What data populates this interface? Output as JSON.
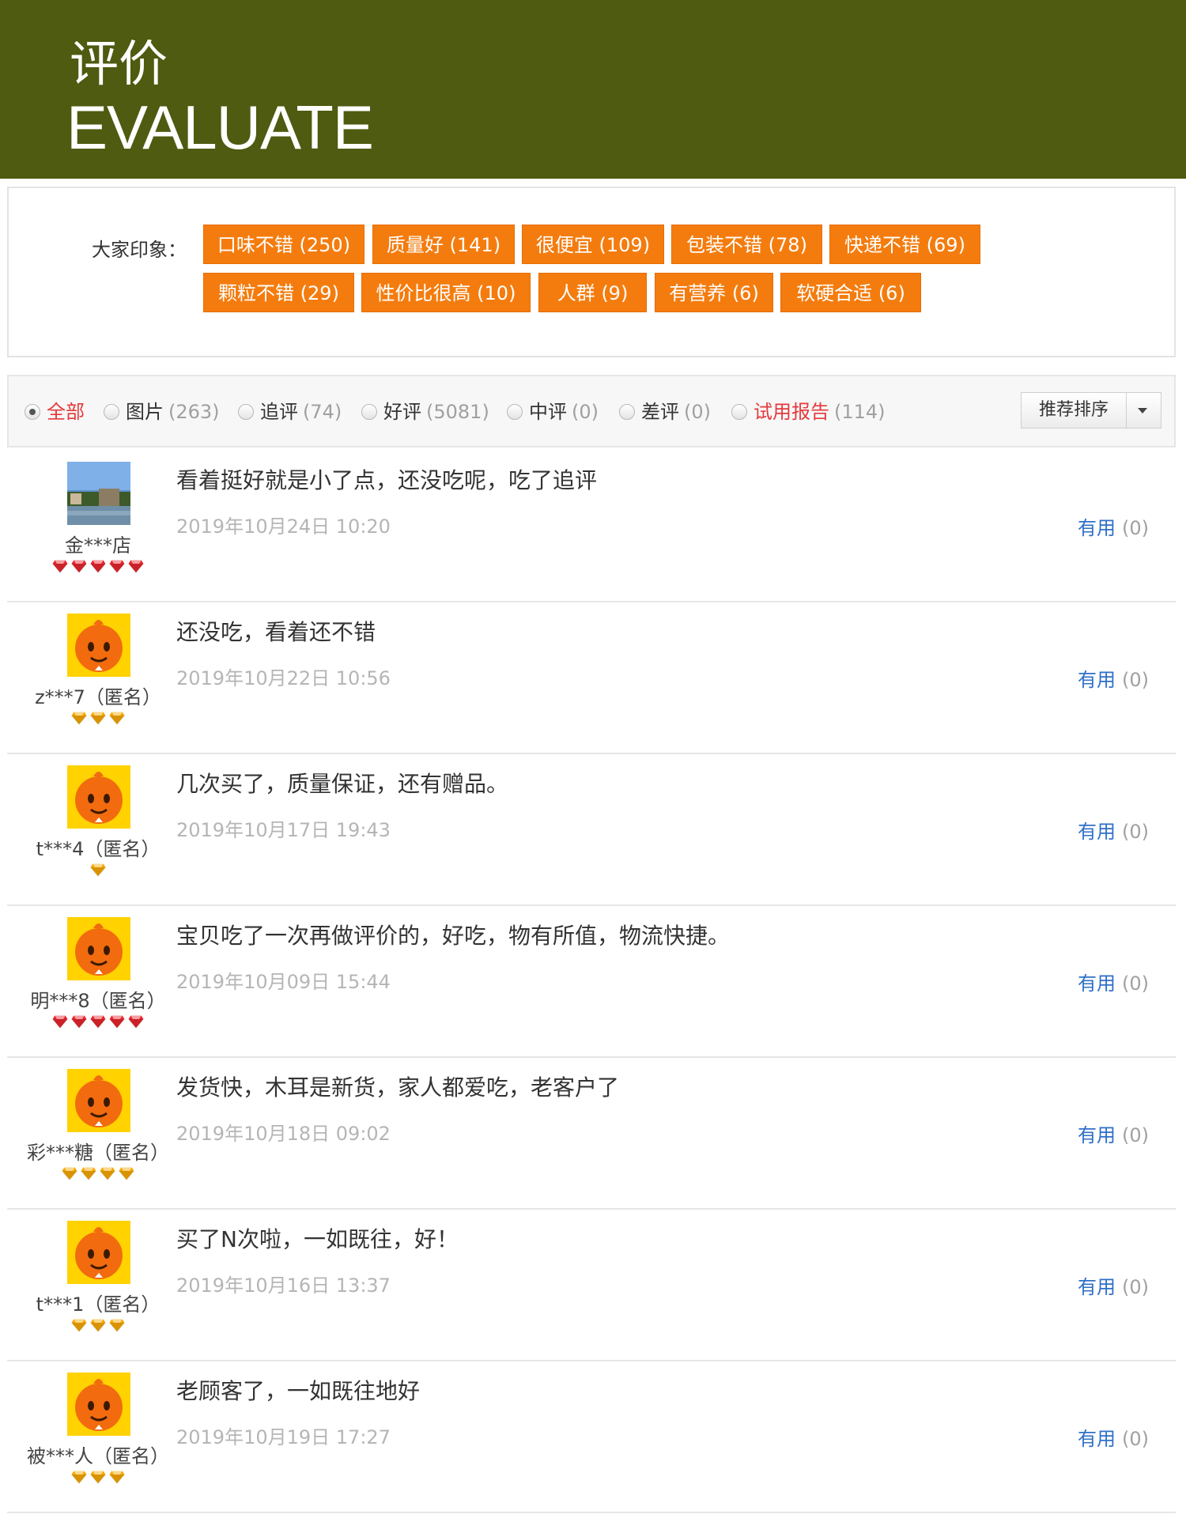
{
  "header": {
    "title_cn": "评价",
    "title_en": "EVALUATE"
  },
  "impressions": {
    "label": "大家印象：",
    "tags": [
      "口味不错 (250)",
      "质量好 (141)",
      "很便宜 (109)",
      "包装不错 (78)",
      "快递不错 (69)",
      "颗粒不错 (29)",
      "性价比很高 (10)",
      "人群 (9)",
      "有营养 (6)",
      "软硬合适 (6)"
    ]
  },
  "filters": {
    "items": [
      {
        "label": "全部",
        "count": "",
        "checked": true,
        "highlight": true
      },
      {
        "label": "图片",
        "count": "(263)",
        "checked": false,
        "highlight": false
      },
      {
        "label": "追评",
        "count": "(74)",
        "checked": false,
        "highlight": false
      },
      {
        "label": "好评",
        "count": "(5081)",
        "checked": false,
        "highlight": false
      },
      {
        "label": "中评",
        "count": "(0)",
        "checked": false,
        "highlight": false
      },
      {
        "label": "差评",
        "count": "(0)",
        "checked": false,
        "highlight": false
      },
      {
        "label": "试用报告",
        "count": "(114)",
        "checked": false,
        "highlight": true
      }
    ],
    "sort_label": "推荐排序"
  },
  "reviews": [
    {
      "nickname": "金***店",
      "avatar": "landscape-photo",
      "level_icon": "red-diamond",
      "level_count": 5,
      "content": "看着挺好就是小了点，还没吃呢，吃了追评",
      "date": "2019年10月24日 10:20",
      "useful_label": "有用",
      "useful_count": "(0)"
    },
    {
      "nickname": "z***7（匿名）",
      "avatar": "orange-mascot",
      "level_icon": "yellow-diamond",
      "level_count": 3,
      "content": "还没吃，看着还不错",
      "date": "2019年10月22日 10:56",
      "useful_label": "有用",
      "useful_count": "(0)"
    },
    {
      "nickname": "t***4（匿名）",
      "avatar": "orange-mascot",
      "level_icon": "yellow-diamond",
      "level_count": 1,
      "content": "几次买了，质量保证，还有赠品。",
      "date": "2019年10月17日 19:43",
      "useful_label": "有用",
      "useful_count": "(0)"
    },
    {
      "nickname": "明***8（匿名）",
      "avatar": "orange-mascot",
      "level_icon": "red-diamond",
      "level_count": 5,
      "content": "宝贝吃了一次再做评价的，好吃，物有所值，物流快捷。",
      "date": "2019年10月09日 15:44",
      "useful_label": "有用",
      "useful_count": "(0)"
    },
    {
      "nickname": "彩***糖（匿名）",
      "avatar": "orange-mascot",
      "level_icon": "yellow-diamond",
      "level_count": 4,
      "content": "发货快，木耳是新货，家人都爱吃，老客户了",
      "date": "2019年10月18日 09:02",
      "useful_label": "有用",
      "useful_count": "(0)"
    },
    {
      "nickname": "t***1（匿名）",
      "avatar": "orange-mascot",
      "level_icon": "yellow-diamond",
      "level_count": 3,
      "content": "买了N次啦，一如既往，好！",
      "date": "2019年10月16日 13:37",
      "useful_label": "有用",
      "useful_count": "(0)"
    },
    {
      "nickname": "被***人（匿名）",
      "avatar": "orange-mascot",
      "level_icon": "yellow-diamond",
      "level_count": 3,
      "content": "老顾客了，一如既往地好",
      "date": "2019年10月19日 17:27",
      "useful_label": "有用",
      "useful_count": "(0)"
    }
  ],
  "colors": {
    "header_bg": "#4e5b10",
    "tag_bg": "#f47c0e",
    "highlight_red": "#e4393c",
    "link_blue": "#2f6fc7",
    "gem_red": "#e8262e",
    "gem_yellow": "#f7a800"
  }
}
